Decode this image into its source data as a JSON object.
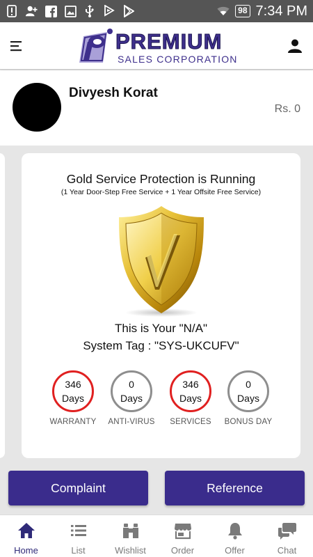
{
  "status_bar": {
    "battery": "98",
    "time": "7:34 PM",
    "icons": [
      "alert-icon",
      "add-user-icon",
      "facebook-icon",
      "image-icon",
      "usb-icon",
      "flag-icon",
      "play-store-icon",
      "wifi-icon",
      "battery-icon"
    ]
  },
  "app_bar": {
    "logo_primary": "PREMIUM",
    "logo_secondary": "SALES CORPORATION",
    "brand_color": "#3e2f8c"
  },
  "profile": {
    "name": "Divyesh Korat",
    "balance": "Rs. 0"
  },
  "protection_card": {
    "title": "Gold Service Protection is Running",
    "subtitle": "(1 Year Door-Step Free Service + 1 Year Offsite Free Service)",
    "tag_line": "This is Your \"N/A\"",
    "system_tag": "System Tag : \"SYS-UKCUFV\"",
    "stats": [
      {
        "value": "346",
        "unit": "Days",
        "label": "WARRANTY",
        "ring_color": "#e02020"
      },
      {
        "value": "0",
        "unit": "Days",
        "label": "ANTI-VIRUS",
        "ring_color": "#8e8e8e"
      },
      {
        "value": "346",
        "unit": "Days",
        "label": "SERVICES",
        "ring_color": "#e02020"
      },
      {
        "value": "0",
        "unit": "Days",
        "label": "BONUS DAY",
        "ring_color": "#8e8e8e"
      }
    ]
  },
  "actions": {
    "complaint": "Complaint",
    "reference": "Reference",
    "color": "#3a2c8c"
  },
  "bottom_nav": {
    "items": [
      {
        "label": "Home",
        "icon": "home-icon",
        "active": true
      },
      {
        "label": "List",
        "icon": "list-icon",
        "active": false
      },
      {
        "label": "Wishlist",
        "icon": "binoculars-icon",
        "active": false
      },
      {
        "label": "Order",
        "icon": "store-icon",
        "active": false
      },
      {
        "label": "Offer",
        "icon": "bell-icon",
        "active": false
      },
      {
        "label": "Chat",
        "icon": "chat-icon",
        "active": false
      }
    ]
  }
}
